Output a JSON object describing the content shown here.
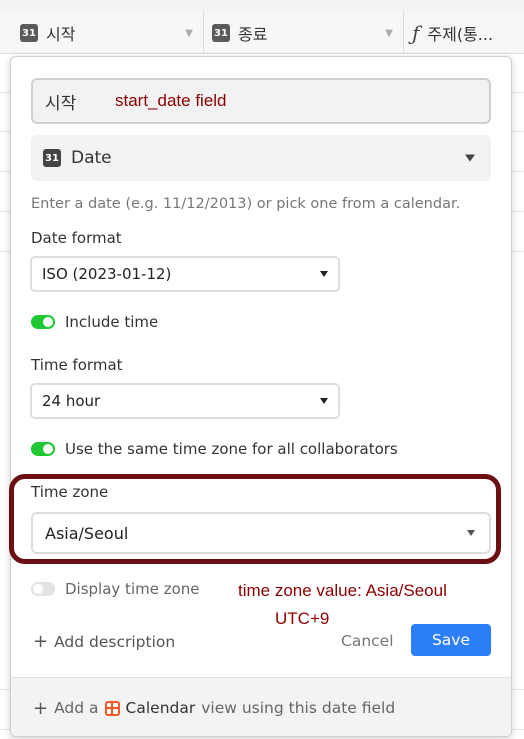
{
  "grid": {
    "columns": [
      {
        "icon": "calendar-icon",
        "icon_text": "31",
        "label": "시작"
      },
      {
        "icon": "calendar-icon",
        "icon_text": "31",
        "label": "종료"
      },
      {
        "icon": "formula-icon",
        "icon_text": "fx",
        "label": "주제(통..."
      }
    ]
  },
  "dialog": {
    "field_name": "시작",
    "field_type": {
      "icon": "calendar-icon",
      "icon_text": "31",
      "label": "Date"
    },
    "helper_text": "Enter a date (e.g. 11/12/2013) or pick one from a calendar.",
    "date_format": {
      "label": "Date format",
      "value": "ISO (2023-01-12)"
    },
    "include_time": {
      "label": "Include time",
      "on": true
    },
    "time_format": {
      "label": "Time format",
      "value": "24 hour"
    },
    "same_timezone": {
      "label": "Use the same time zone for all collaborators",
      "on": true
    },
    "time_zone": {
      "label": "Time zone",
      "value": "Asia/Seoul"
    },
    "display_time_zone": {
      "label": "Display time zone",
      "on": false
    },
    "add_description": "Add description",
    "cancel": "Cancel",
    "save": "Save",
    "footer": {
      "prefix": "Add a",
      "view_name": "Calendar",
      "suffix": "view using this date field"
    }
  },
  "annotations": {
    "field_note": "start_date field",
    "tz_note_line1": "time zone value: Asia/Seoul",
    "tz_note_line2": "UTC+9",
    "highlight_color": "#6b0f14",
    "text_color": "#8b0000"
  },
  "colors": {
    "accent": "#2d7ff9",
    "toggle_on": "#20c933",
    "calendar_view": "#f05a28"
  }
}
